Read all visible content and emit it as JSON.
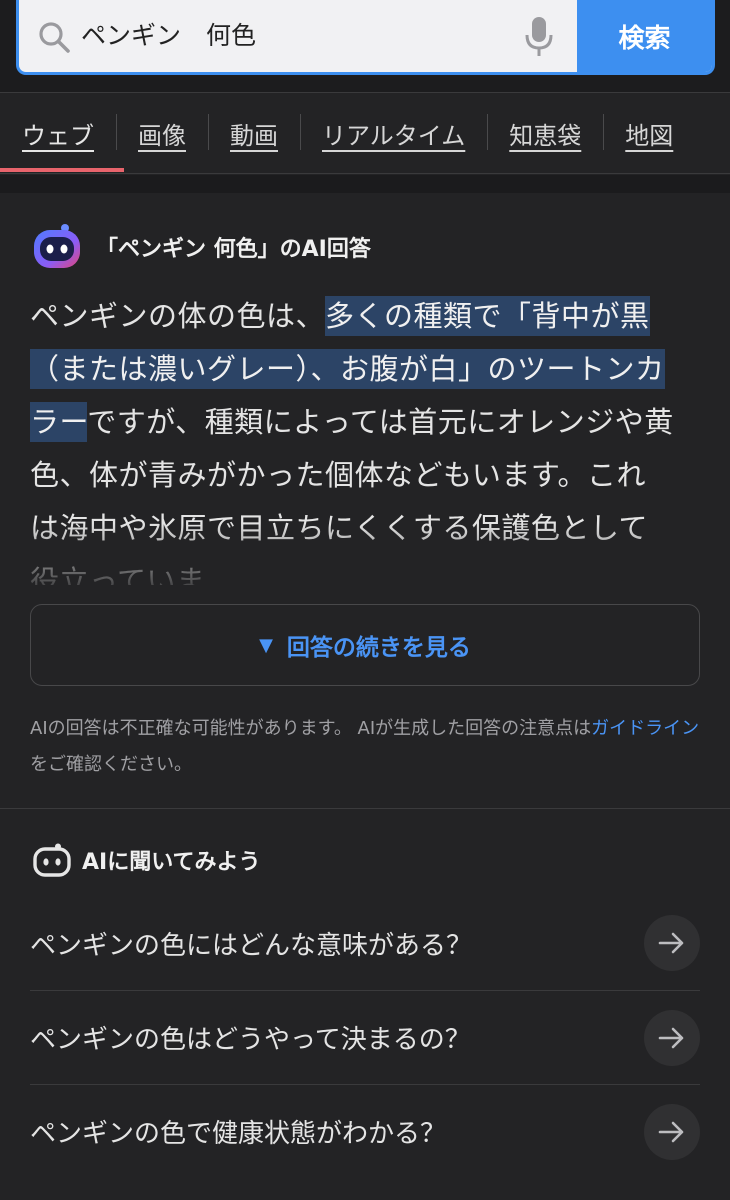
{
  "search": {
    "query": "ペンギン　何色",
    "button_label": "検索"
  },
  "tabs": [
    {
      "label": "ウェブ",
      "active": true
    },
    {
      "label": "画像"
    },
    {
      "label": "動画"
    },
    {
      "label": "リアルタイム"
    },
    {
      "label": "知恵袋"
    },
    {
      "label": "地図"
    }
  ],
  "ai_answer": {
    "title": "「ペンギン 何色」のAI回答",
    "body_before": "ペンギンの体の色は、",
    "body_highlight": "多くの種類で「背中が黒（または濃いグレー）、お腹が白」のツートンカラー",
    "body_after": "ですが、種類によっては首元にオレンジや黄色、体が青みがかった個体などもいます。これは海中や氷原で目立ちにくくする保護色として役立っていま",
    "more_label": "回答の続きを見る",
    "disclaimer_before": "AIの回答は不正確な可能性があります。 AIが生成した回答の注意点は",
    "disclaimer_link": "ガイドライン",
    "disclaimer_after": "をご確認ください。"
  },
  "ask_ai": {
    "title": "AIに聞いてみよう",
    "questions": [
      "ペンギンの色にはどんな意味がある？",
      "ペンギンの色はどうやって決まるの？",
      "ペンギンの色で健康状態がわかる？"
    ]
  },
  "colors": {
    "accent": "#3d8ff0",
    "tab_underline": "#e8646c",
    "link": "#4a94f5",
    "highlight": "#2c4466"
  },
  "icons": [
    "search-icon",
    "mic-icon",
    "ai-assistant-icon",
    "robot-icon",
    "arrow-right-icon"
  ]
}
